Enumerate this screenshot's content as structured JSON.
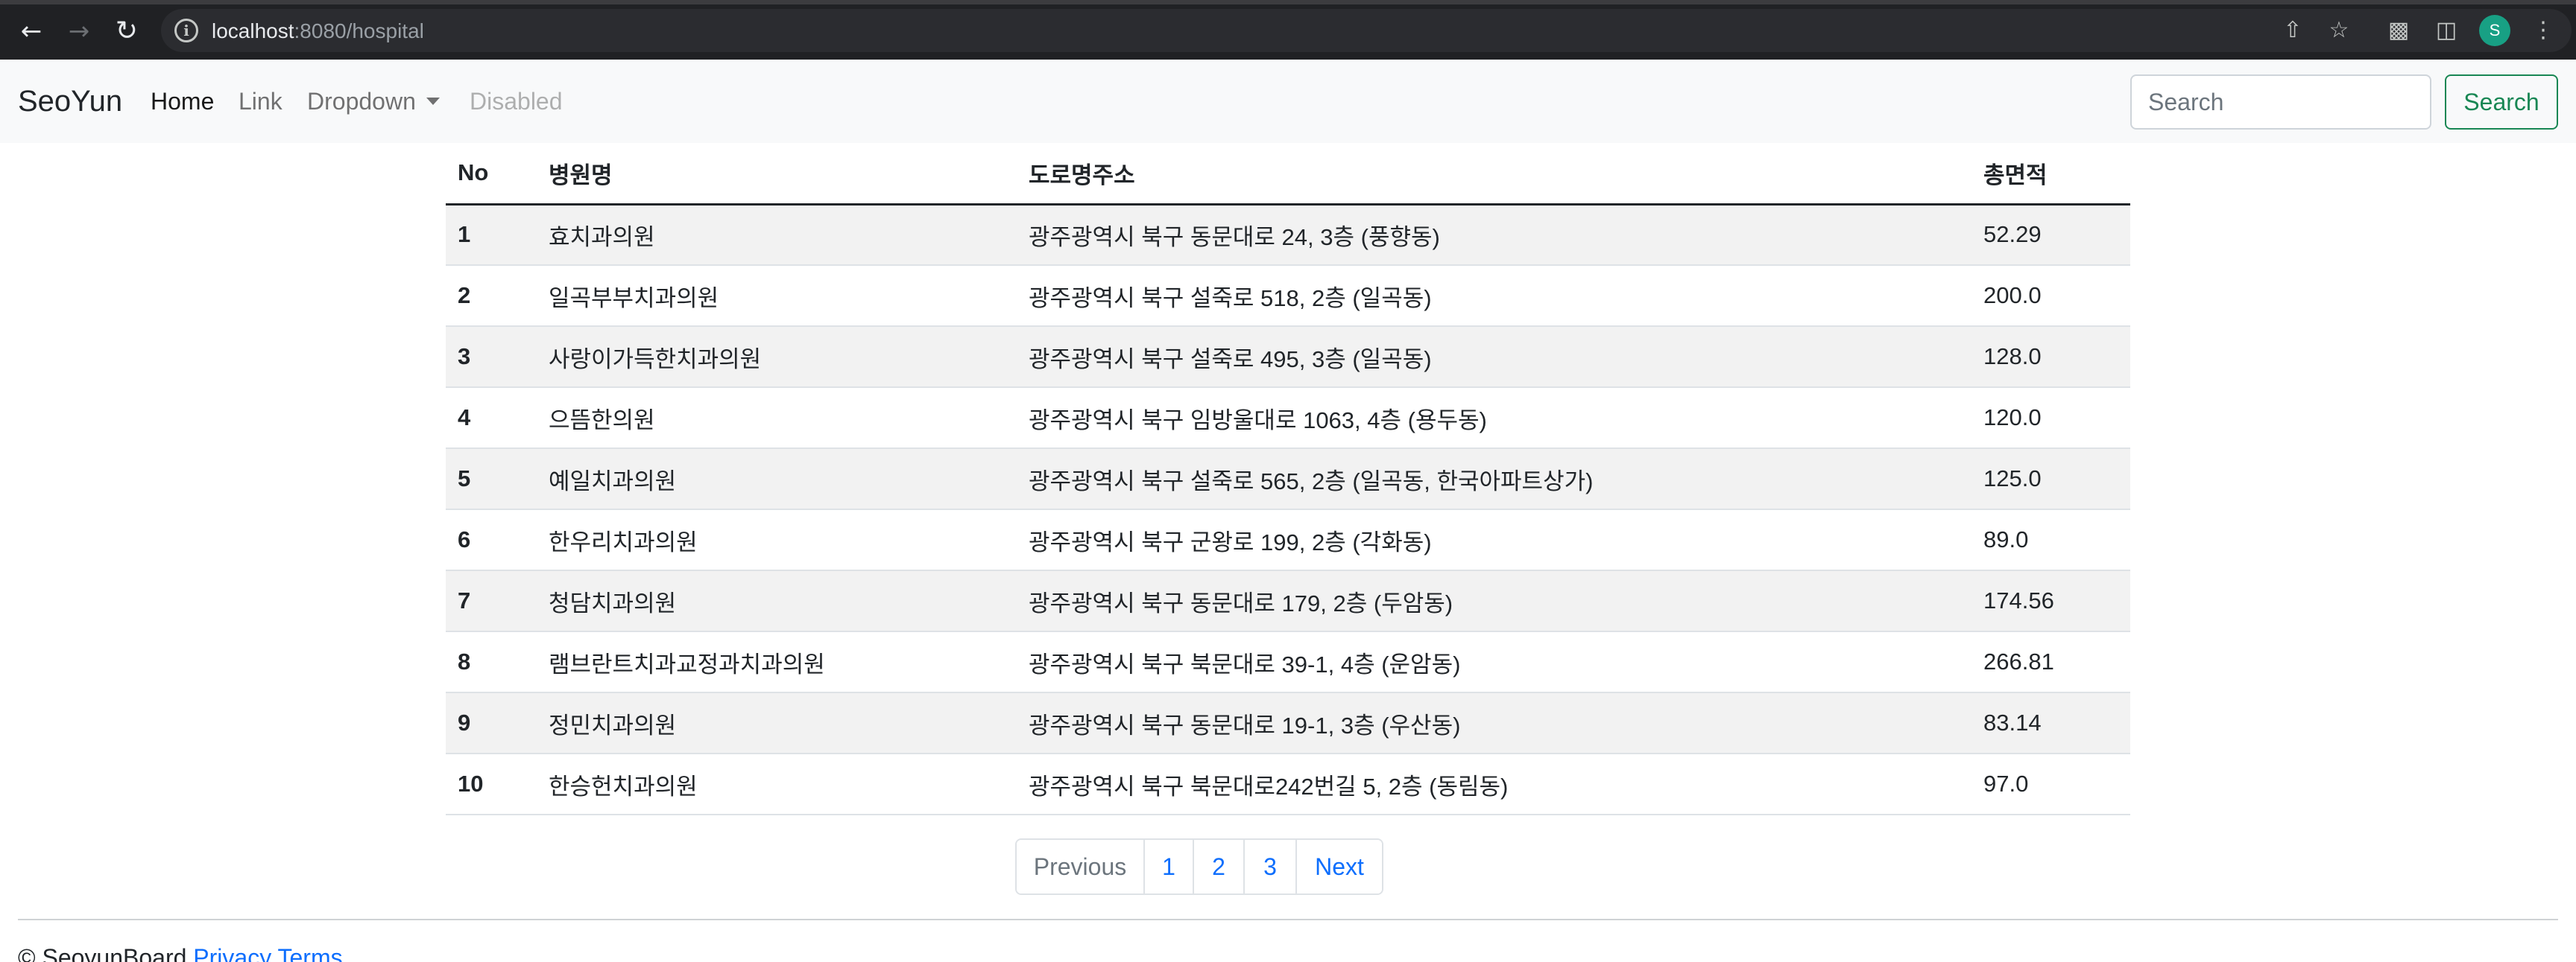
{
  "browser": {
    "url_host": "localhost",
    "url_rest": ":8080/hospital",
    "avatar_letter": "S"
  },
  "navbar": {
    "brand": "SeoYun",
    "links": [
      "Home",
      "Link",
      "Dropdown",
      "Disabled"
    ],
    "search_placeholder": "Search",
    "search_button": "Search"
  },
  "table": {
    "headers": [
      "No",
      "병원명",
      "도로명주소",
      "총면적"
    ],
    "rows": [
      [
        "1",
        "효치과의원",
        "광주광역시 북구 동문대로 24, 3층 (풍향동)",
        "52.29"
      ],
      [
        "2",
        "일곡부부치과의원",
        "광주광역시 북구 설죽로 518, 2층 (일곡동)",
        "200.0"
      ],
      [
        "3",
        "사랑이가득한치과의원",
        "광주광역시 북구 설죽로 495, 3층 (일곡동)",
        "128.0"
      ],
      [
        "4",
        "으뜸한의원",
        "광주광역시 북구 임방울대로 1063, 4층 (용두동)",
        "120.0"
      ],
      [
        "5",
        "예일치과의원",
        "광주광역시 북구 설죽로 565, 2층 (일곡동, 한국아파트상가)",
        "125.0"
      ],
      [
        "6",
        "한우리치과의원",
        "광주광역시 북구 군왕로 199, 2층 (각화동)",
        "89.0"
      ],
      [
        "7",
        "청담치과의원",
        "광주광역시 북구 동문대로 179, 2층 (두암동)",
        "174.56"
      ],
      [
        "8",
        "램브란트치과교정과치과의원",
        "광주광역시 북구 북문대로 39-1, 4층 (운암동)",
        "266.81"
      ],
      [
        "9",
        "정민치과의원",
        "광주광역시 북구 동문대로 19-1, 3층 (우산동)",
        "83.14"
      ],
      [
        "10",
        "한승헌치과의원",
        "광주광역시 북구 북문대로242번길 5, 2층 (동림동)",
        "97.0"
      ]
    ]
  },
  "pagination": {
    "previous": "Previous",
    "pages": [
      "1",
      "2",
      "3"
    ],
    "next": "Next"
  },
  "footer": {
    "copyright": "© SeoyunBoard",
    "links": [
      "Privacy",
      "Terms"
    ]
  }
}
